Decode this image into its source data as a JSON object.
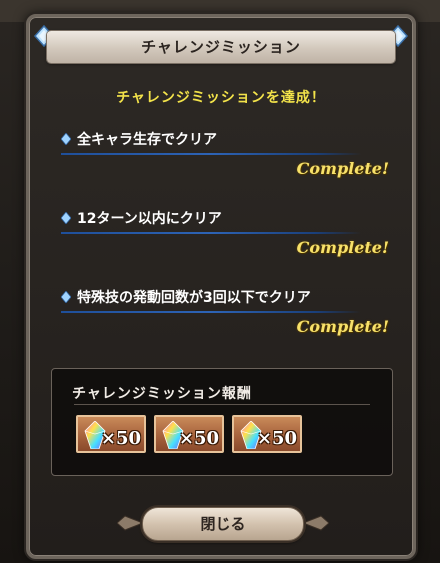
{
  "dialog": {
    "title": "チャレンジミッション",
    "headline": "チャレンジミッションを達成！",
    "missions": [
      {
        "label": "全キャラ生存でクリア",
        "status": "Complete!"
      },
      {
        "label": "12ターン以内にクリア",
        "status": "Complete!"
      },
      {
        "label": "特殊技の発動回数が3回以下でクリア",
        "status": "Complete!"
      }
    ],
    "reward": {
      "title": "チャレンジミッション報酬",
      "items": [
        {
          "icon": "rainbow-crystal-icon",
          "qty": "×50"
        },
        {
          "icon": "rainbow-crystal-icon",
          "qty": "×50"
        },
        {
          "icon": "rainbow-crystal-icon",
          "qty": "×50"
        }
      ]
    },
    "close_label": "閉じる"
  },
  "colors": {
    "headline": "#f3e34a",
    "complete": "#f7e16a",
    "mission_line": "#2d63b5",
    "reward_item": "#a4603b"
  }
}
